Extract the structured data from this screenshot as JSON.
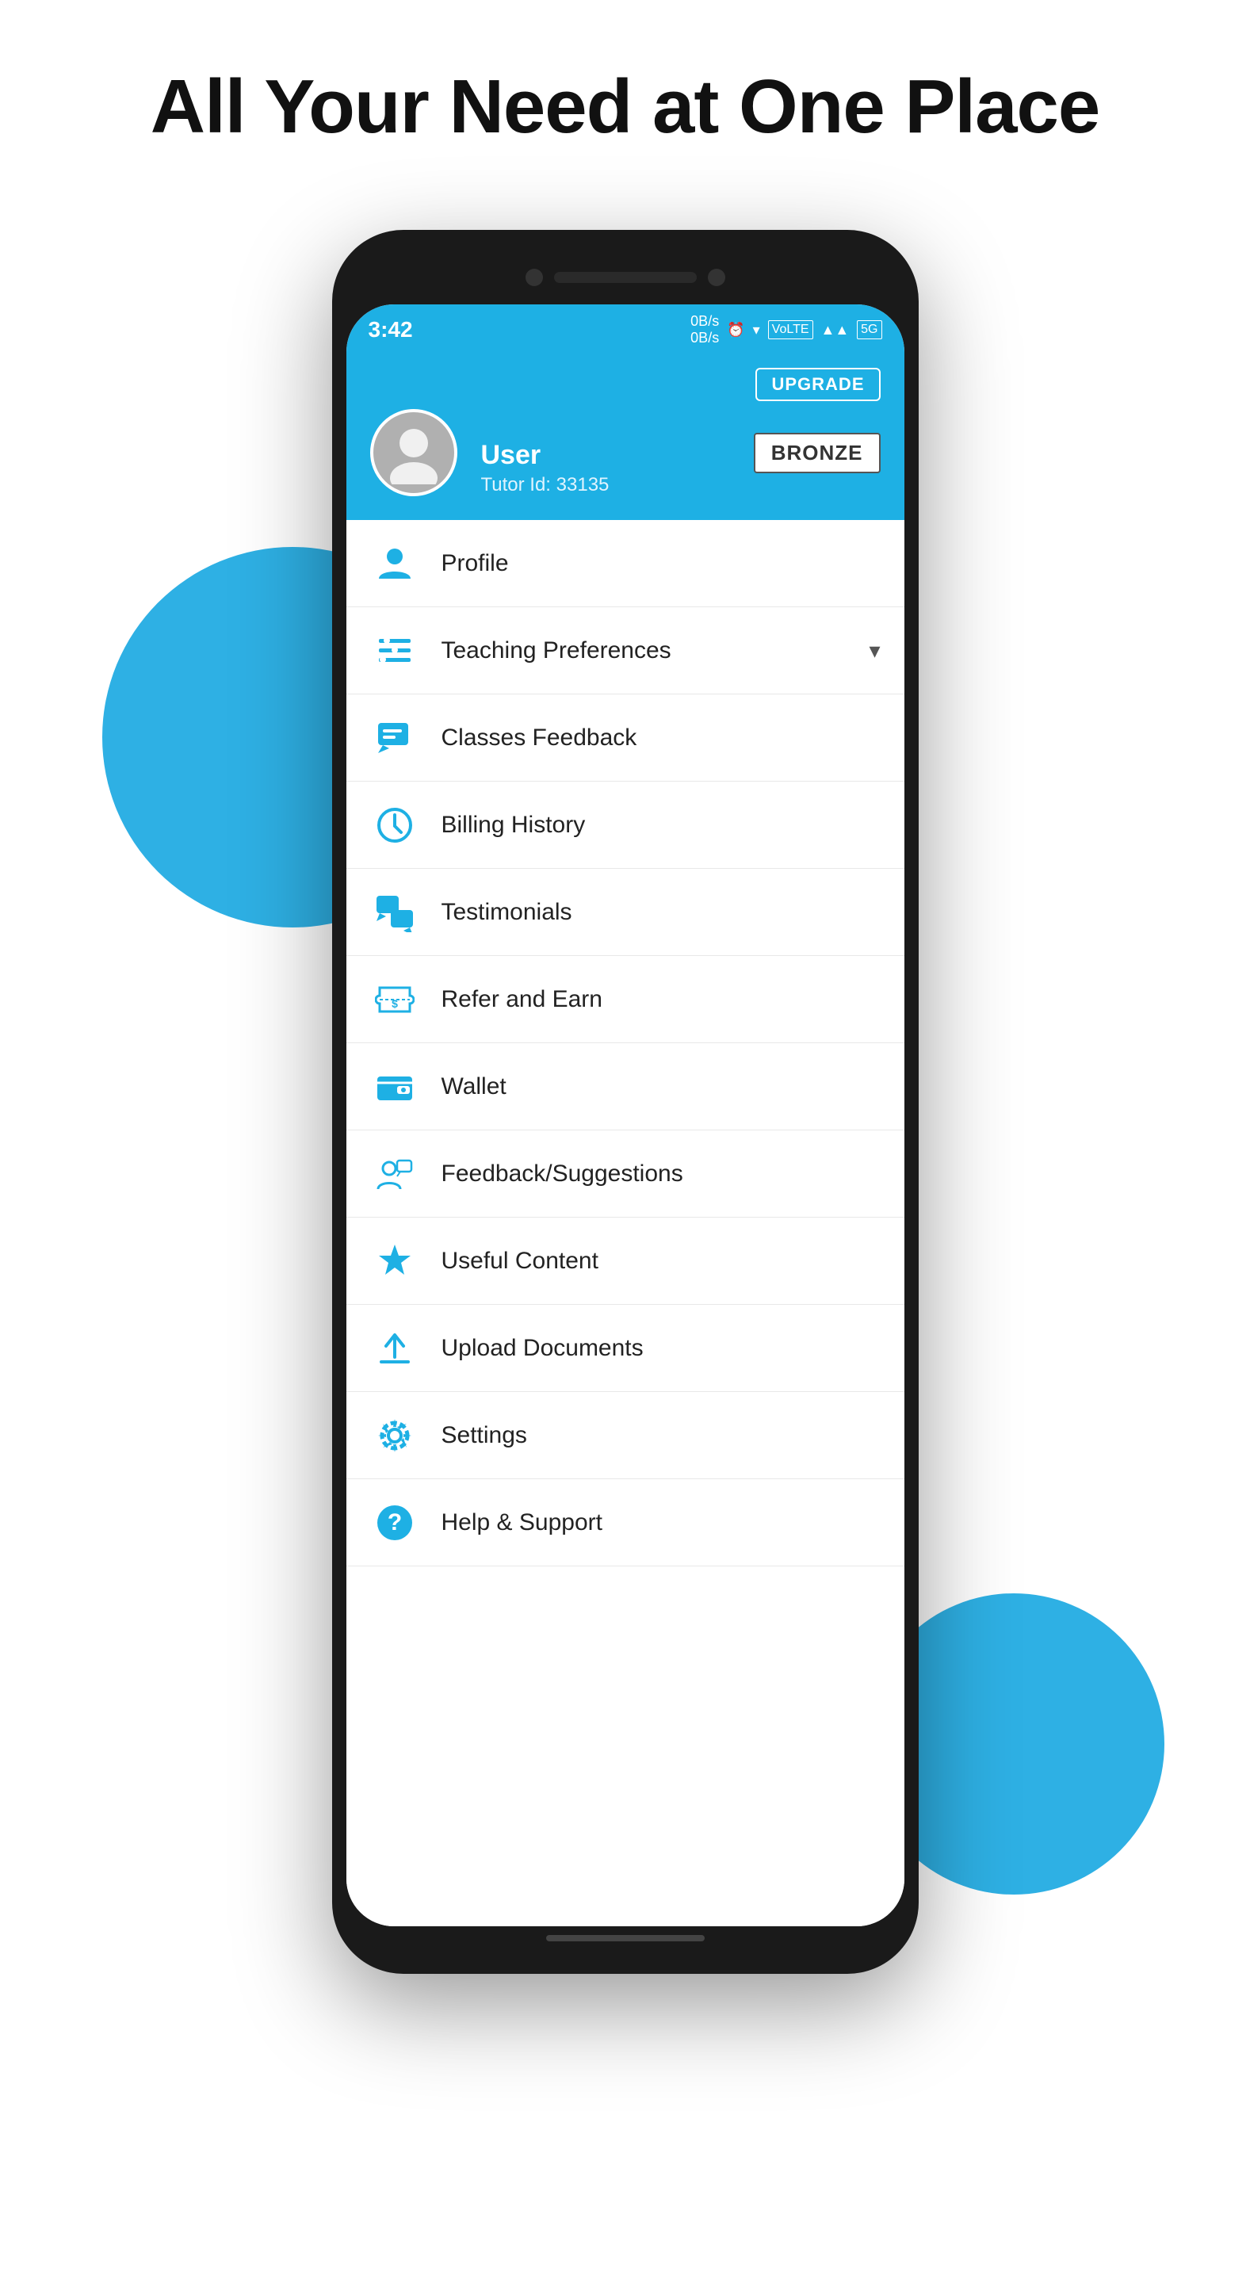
{
  "page": {
    "headline": "All Your Need at One Place"
  },
  "status_bar": {
    "time": "3:42",
    "data": "0B/s 0B/s",
    "icons": "⏰ ▾ VoLTE ▲▲ 5G"
  },
  "header": {
    "upgrade_label": "UPGRADE",
    "user_name": "User",
    "user_id": "Tutor Id: 33135",
    "badge": "BRONZE"
  },
  "menu": {
    "items": [
      {
        "id": "profile",
        "label": "Profile",
        "icon": "person",
        "has_chevron": false
      },
      {
        "id": "teaching-preferences",
        "label": "Teaching Preferences",
        "icon": "list",
        "has_chevron": true
      },
      {
        "id": "classes-feedback",
        "label": "Classes Feedback",
        "icon": "feedback",
        "has_chevron": false
      },
      {
        "id": "billing-history",
        "label": "Billing History",
        "icon": "history",
        "has_chevron": false
      },
      {
        "id": "testimonials",
        "label": "Testimonials",
        "icon": "chat",
        "has_chevron": false
      },
      {
        "id": "refer-and-earn",
        "label": "Refer and Earn",
        "icon": "refer",
        "has_chevron": false
      },
      {
        "id": "wallet",
        "label": "Wallet",
        "icon": "wallet",
        "has_chevron": false
      },
      {
        "id": "feedback-suggestions",
        "label": "Feedback/Suggestions",
        "icon": "suggestion",
        "has_chevron": false
      },
      {
        "id": "useful-content",
        "label": "Useful Content",
        "icon": "star",
        "has_chevron": false
      },
      {
        "id": "upload-documents",
        "label": "Upload Documents",
        "icon": "upload",
        "has_chevron": false
      },
      {
        "id": "settings",
        "label": "Settings",
        "icon": "settings",
        "has_chevron": false
      },
      {
        "id": "help-support",
        "label": "Help & Support",
        "icon": "help",
        "has_chevron": false
      }
    ]
  }
}
